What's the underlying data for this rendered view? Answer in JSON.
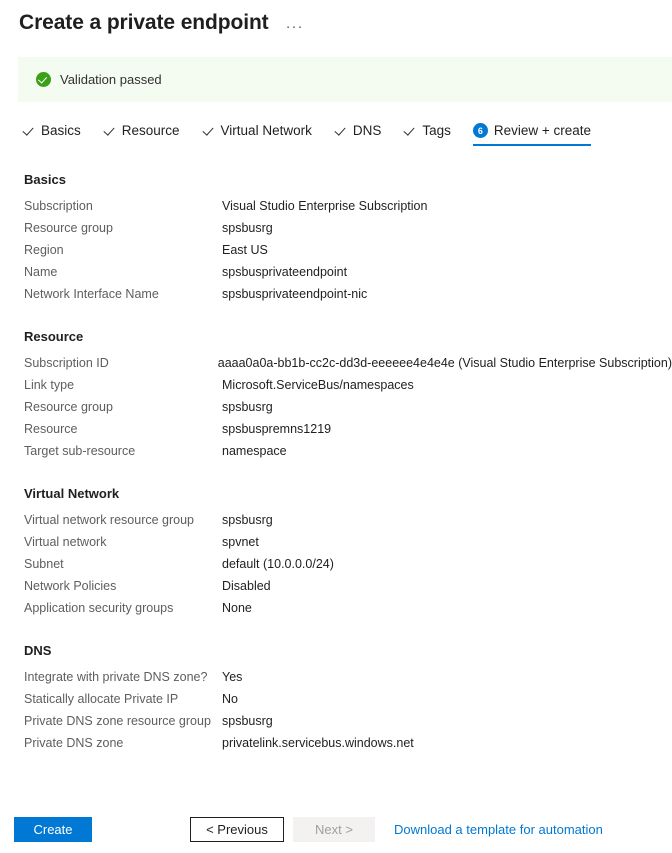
{
  "header": {
    "title": "Create a private endpoint",
    "ellipsis": "···"
  },
  "validation": {
    "icon": "check-circle-icon",
    "message": "Validation passed",
    "background_color": "#f4fbf0",
    "icon_color": "#3aa017"
  },
  "tabs": [
    {
      "label": "Basics",
      "state": "completed",
      "indicator": "check"
    },
    {
      "label": "Resource",
      "state": "completed",
      "indicator": "check"
    },
    {
      "label": "Virtual Network",
      "state": "completed",
      "indicator": "check"
    },
    {
      "label": "DNS",
      "state": "completed",
      "indicator": "check"
    },
    {
      "label": "Tags",
      "state": "completed",
      "indicator": "check"
    },
    {
      "label": "Review + create",
      "state": "active",
      "indicator": "badge",
      "badge": "6"
    }
  ],
  "sections": [
    {
      "heading": "Basics",
      "rows": [
        {
          "label": "Subscription",
          "value": "Visual Studio Enterprise Subscription"
        },
        {
          "label": "Resource group",
          "value": "spsbusrg"
        },
        {
          "label": "Region",
          "value": "East US"
        },
        {
          "label": "Name",
          "value": "spsbusprivateendpoint"
        },
        {
          "label": "Network Interface Name",
          "value": "spsbusprivateendpoint-nic"
        }
      ]
    },
    {
      "heading": "Resource",
      "rows": [
        {
          "label": "Subscription ID",
          "value": "aaaa0a0a-bb1b-cc2c-dd3d-eeeeee4e4e4e (Visual Studio Enterprise Subscription)"
        },
        {
          "label": "Link type",
          "value": "Microsoft.ServiceBus/namespaces"
        },
        {
          "label": "Resource group",
          "value": "spsbusrg"
        },
        {
          "label": "Resource",
          "value": "spsbuspremns1219"
        },
        {
          "label": "Target sub-resource",
          "value": "namespace"
        }
      ]
    },
    {
      "heading": "Virtual Network",
      "rows": [
        {
          "label": "Virtual network resource group",
          "value": "spsbusrg"
        },
        {
          "label": "Virtual network",
          "value": "spvnet"
        },
        {
          "label": "Subnet",
          "value": "default (10.0.0.0/24)"
        },
        {
          "label": "Network Policies",
          "value": "Disabled"
        },
        {
          "label": "Application security groups",
          "value": "None"
        }
      ]
    },
    {
      "heading": "DNS",
      "rows": [
        {
          "label": "Integrate with private DNS zone?",
          "value": "Yes"
        },
        {
          "label": "Statically allocate Private IP",
          "value": "No"
        },
        {
          "label": "Private DNS zone resource group",
          "value": "spsbusrg"
        },
        {
          "label": "Private DNS zone",
          "value": "privatelink.servicebus.windows.net"
        }
      ]
    }
  ],
  "footer": {
    "create_label": "Create",
    "previous_label": "< Previous",
    "next_label": "Next >",
    "next_disabled": true,
    "template_link_label": "Download a template for automation",
    "accent_color": "#0078d4"
  }
}
